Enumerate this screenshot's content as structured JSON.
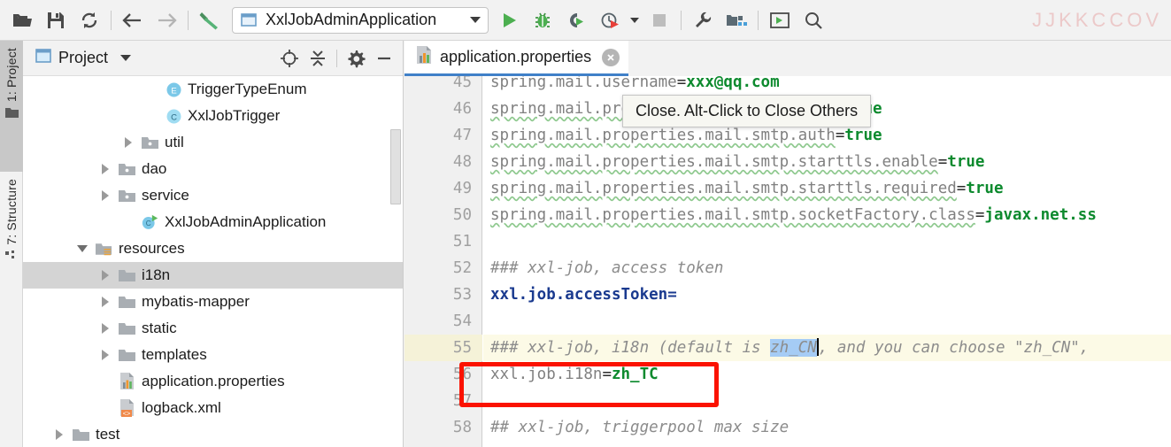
{
  "toolbar": {
    "buttons": [
      {
        "name": "open-folder-icon",
        "tip": "Open"
      },
      {
        "name": "save-all-icon",
        "tip": "Save All"
      },
      {
        "name": "sync-icon",
        "tip": "Synchronize"
      },
      {
        "name": "back-icon",
        "tip": "Back"
      },
      {
        "name": "forward-icon",
        "tip": "Forward"
      },
      {
        "name": "build-hammer-icon",
        "tip": "Build Project"
      }
    ],
    "run_config": {
      "label": "XxlJobAdminApplication",
      "icon": "run-config-icon"
    },
    "run_buttons": [
      {
        "name": "run-icon",
        "tip": "Run"
      },
      {
        "name": "debug-icon",
        "tip": "Debug"
      },
      {
        "name": "run-coverage-icon",
        "tip": "Run with Coverage"
      },
      {
        "name": "profiler-icon",
        "tip": "Profiler"
      },
      {
        "name": "stop-icon",
        "tip": "Stop"
      },
      {
        "name": "wrench-icon",
        "tip": "Settings"
      },
      {
        "name": "project-structure-icon",
        "tip": "Project Structure"
      },
      {
        "name": "updating-icon",
        "tip": "Update Running Application"
      },
      {
        "name": "search-everywhere-icon",
        "tip": "Search Everywhere"
      }
    ],
    "watermark": "JJKKCCOV"
  },
  "tool_window_bar": {
    "tabs": [
      {
        "label": "1: Project",
        "icon": "project-folder-icon",
        "active": true
      },
      {
        "label": "7: Structure",
        "icon": "structure-icon",
        "active": false
      }
    ]
  },
  "project_panel": {
    "title": "Project",
    "header_icons": [
      {
        "name": "locate-icon",
        "tip": "Select Opened File"
      },
      {
        "name": "collapse-all-icon",
        "tip": "Collapse All"
      },
      {
        "name": "gear-icon",
        "tip": "Settings"
      },
      {
        "name": "minimize-icon",
        "tip": "Hide"
      }
    ],
    "tree": [
      {
        "label": "TriggerTypeEnum",
        "indent": 5,
        "arrow": "none",
        "icon": "enum-icon",
        "selected": false
      },
      {
        "label": "XxlJobTrigger",
        "indent": 5,
        "arrow": "none",
        "icon": "class-icon",
        "selected": false
      },
      {
        "label": "util",
        "indent": 4,
        "arrow": "closed",
        "icon": "package-icon",
        "selected": false
      },
      {
        "label": "dao",
        "indent": 3,
        "arrow": "closed",
        "icon": "package-icon",
        "selected": false
      },
      {
        "label": "service",
        "indent": 3,
        "arrow": "closed",
        "icon": "package-icon",
        "selected": false
      },
      {
        "label": "XxlJobAdminApplication",
        "indent": 4,
        "arrow": "none",
        "icon": "runnable-class-icon",
        "selected": false
      },
      {
        "label": "resources",
        "indent": 2,
        "arrow": "open",
        "icon": "resources-icon",
        "selected": false
      },
      {
        "label": "i18n",
        "indent": 3,
        "arrow": "closed",
        "icon": "folder-icon",
        "selected": true
      },
      {
        "label": "mybatis-mapper",
        "indent": 3,
        "arrow": "closed",
        "icon": "folder-icon",
        "selected": false
      },
      {
        "label": "static",
        "indent": 3,
        "arrow": "closed",
        "icon": "folder-icon",
        "selected": false
      },
      {
        "label": "templates",
        "indent": 3,
        "arrow": "closed",
        "icon": "folder-icon",
        "selected": false
      },
      {
        "label": "application.properties",
        "indent": 3,
        "arrow": "none",
        "icon": "properties-icon",
        "selected": false
      },
      {
        "label": "logback.xml",
        "indent": 3,
        "arrow": "none",
        "icon": "xml-icon",
        "selected": false
      },
      {
        "label": "test",
        "indent": 1,
        "arrow": "closed",
        "icon": "folder-icon",
        "selected": false
      }
    ]
  },
  "editor": {
    "tab": {
      "label": "application.properties",
      "icon": "properties-icon",
      "close_icon": "close-icon"
    },
    "tooltip": "Close. Alt-Click to Close Others",
    "lines": [
      {
        "num": "45",
        "segs": [
          {
            "t": "spring.mail.username",
            "c": "k"
          },
          {
            "t": "=",
            "c": "eq"
          },
          {
            "t": "xxx@qq.com",
            "c": "v"
          }
        ]
      },
      {
        "num": "46",
        "segs": [
          {
            "t": "spring.mail.properties.mail.smtp.auth",
            "c": "k squig"
          },
          {
            "t": "=",
            "c": "eq"
          },
          {
            "t": "true",
            "c": "v"
          }
        ]
      },
      {
        "num": "47",
        "segs": [
          {
            "t": "spring.mail.properties.mail.smtp.auth",
            "c": "k squig"
          },
          {
            "t": "=",
            "c": "eq"
          },
          {
            "t": "true",
            "c": "v"
          }
        ]
      },
      {
        "num": "48",
        "segs": [
          {
            "t": "spring.mail.properties.mail.smtp.starttls.enable",
            "c": "k squig"
          },
          {
            "t": "=",
            "c": "eq"
          },
          {
            "t": "true",
            "c": "v"
          }
        ]
      },
      {
        "num": "49",
        "segs": [
          {
            "t": "spring.mail.properties.mail.smtp.starttls.required",
            "c": "k squig"
          },
          {
            "t": "=",
            "c": "eq"
          },
          {
            "t": "true",
            "c": "v"
          }
        ]
      },
      {
        "num": "50",
        "segs": [
          {
            "t": "spring.mail.properties.mail.smtp.socketFactory.class",
            "c": "k squig"
          },
          {
            "t": "=",
            "c": "eq"
          },
          {
            "t": "javax.net.ss",
            "c": "v"
          }
        ]
      },
      {
        "num": "51",
        "segs": []
      },
      {
        "num": "52",
        "segs": [
          {
            "t": "### xxl-job, access token",
            "c": "cmt"
          }
        ]
      },
      {
        "num": "53",
        "segs": [
          {
            "t": "xxl.job.accessToken",
            "c": "k-blue"
          },
          {
            "t": "=",
            "c": "k-blue"
          }
        ]
      },
      {
        "num": "54",
        "segs": []
      },
      {
        "num": "55",
        "highlight": true,
        "segs": [
          {
            "t": "### xxl-job, i18n (default is ",
            "c": "cmt"
          },
          {
            "t": "zh_CN",
            "c": "cmt sel-hl"
          },
          {
            "t": "CARET",
            "c": "caret"
          },
          {
            "t": ", and you can choose \"zh_CN\",",
            "c": "cmt"
          }
        ]
      },
      {
        "num": "56",
        "segs": [
          {
            "t": "xxl.job.i18n",
            "c": "k"
          },
          {
            "t": "=",
            "c": "eq"
          },
          {
            "t": "zh_TC",
            "c": "v"
          }
        ]
      },
      {
        "num": "57",
        "segs": []
      },
      {
        "num": "58",
        "segs": [
          {
            "t": "## xxl-job, triggerpool max size",
            "c": "cmt"
          }
        ]
      }
    ]
  },
  "annotation": {
    "name": "red-highlight-box",
    "color": "#fb1200",
    "target_line": "56"
  }
}
